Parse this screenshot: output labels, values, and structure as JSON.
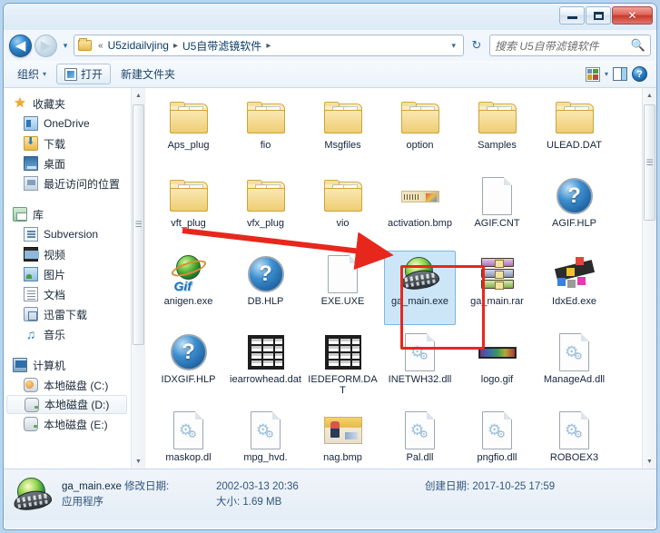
{
  "window": {
    "controls": {
      "minimize": "—",
      "maximize": "❐",
      "close": "✕"
    }
  },
  "address": {
    "back_label": "◀",
    "forward_label": "▶",
    "history_caret": "▾",
    "crumb_prefix": "«",
    "crumbs": [
      "U5zidailvjing",
      "U5自带滤镜软件"
    ],
    "separator": "▸",
    "dropdown_caret": "▾",
    "refresh_label": "↻"
  },
  "search": {
    "placeholder": "搜索 U5自带滤镜软件",
    "icon": "search-icon"
  },
  "toolbar": {
    "organize": "组织",
    "organize_caret": "▾",
    "open": "打开",
    "new_folder": "新建文件夹",
    "view_caret": "▾",
    "help": "?"
  },
  "sidebar": {
    "groups": [
      {
        "header": {
          "label": "收藏夹",
          "icon": "star-icon"
        },
        "items": [
          {
            "label": "OneDrive",
            "icon": "onedrive-icon"
          },
          {
            "label": "下载",
            "icon": "downloads-icon"
          },
          {
            "label": "桌面",
            "icon": "desktop-icon"
          },
          {
            "label": "最近访问的位置",
            "icon": "recent-places-icon"
          }
        ]
      },
      {
        "header": {
          "label": "库",
          "icon": "library-icon"
        },
        "items": [
          {
            "label": "Subversion",
            "icon": "subversion-icon"
          },
          {
            "label": "视频",
            "icon": "video-icon"
          },
          {
            "label": "图片",
            "icon": "pictures-icon"
          },
          {
            "label": "文档",
            "icon": "documents-icon"
          },
          {
            "label": "迅雷下载",
            "icon": "xunlei-icon"
          },
          {
            "label": "音乐",
            "icon": "music-icon"
          }
        ]
      },
      {
        "header": {
          "label": "计算机",
          "icon": "computer-icon"
        },
        "items": [
          {
            "label": "本地磁盘 (C:)",
            "icon": "drive-system-icon"
          },
          {
            "label": "本地磁盘 (D:)",
            "icon": "drive-icon",
            "selected": true
          },
          {
            "label": "本地磁盘 (E:)",
            "icon": "drive-icon"
          }
        ]
      }
    ]
  },
  "files": [
    {
      "name": "Aps_plug",
      "kind": "folder"
    },
    {
      "name": "fio",
      "kind": "folder"
    },
    {
      "name": "Msgfiles",
      "kind": "folder"
    },
    {
      "name": "option",
      "kind": "folder"
    },
    {
      "name": "Samples",
      "kind": "folder"
    },
    {
      "name": "ULEAD.DAT",
      "kind": "folder"
    },
    {
      "name": "vft_plug",
      "kind": "folder"
    },
    {
      "name": "vfx_plug",
      "kind": "folder"
    },
    {
      "name": "vio",
      "kind": "folder"
    },
    {
      "name": "activation.bmp",
      "kind": "bmp-activation"
    },
    {
      "name": "AGIF.CNT",
      "kind": "blank-page"
    },
    {
      "name": "AGIF.HLP",
      "kind": "help"
    },
    {
      "name": "anigen.exe",
      "kind": "gif-globe"
    },
    {
      "name": "DB.HLP",
      "kind": "help"
    },
    {
      "name": "EXE.UXE",
      "kind": "blank-page"
    },
    {
      "name": "ga_main.exe",
      "kind": "media-globe",
      "selected": true
    },
    {
      "name": "ga_main.rar",
      "kind": "rar"
    },
    {
      "name": "IdxEd.exe",
      "kind": "idx-cubes"
    },
    {
      "name": "IDXGIF.HLP",
      "kind": "help"
    },
    {
      "name": "iearrowhead.dat",
      "kind": "dat-table"
    },
    {
      "name": "IEDEFORM.DAT",
      "kind": "dat-table"
    },
    {
      "name": "INETWH32.dll",
      "kind": "dll"
    },
    {
      "name": "logo.gif",
      "kind": "bmp-logo"
    },
    {
      "name": "ManageAd.dll",
      "kind": "dll"
    },
    {
      "name": "maskop.dl",
      "kind": "dll"
    },
    {
      "name": "mpg_hvd.",
      "kind": "dll"
    },
    {
      "name": "nag.bmp",
      "kind": "bmp-nag"
    },
    {
      "name": "Pal.dll",
      "kind": "dll"
    },
    {
      "name": "pngfio.dll",
      "kind": "dll"
    },
    {
      "name": "ROBOEX3",
      "kind": "dll"
    }
  ],
  "status": {
    "file_name": "ga_main.exe",
    "modified_label": "修改日期:",
    "modified_value": "2002-03-13 20:36",
    "created_label": "创建日期:",
    "created_value": "2017-10-25 17:59",
    "type": "应用程序",
    "size_label": "大小:",
    "size_value": "1.69 MB"
  },
  "colors": {
    "annotation": "#e8271c",
    "selection": "#cde6f7",
    "close_button": "#c8392c"
  }
}
